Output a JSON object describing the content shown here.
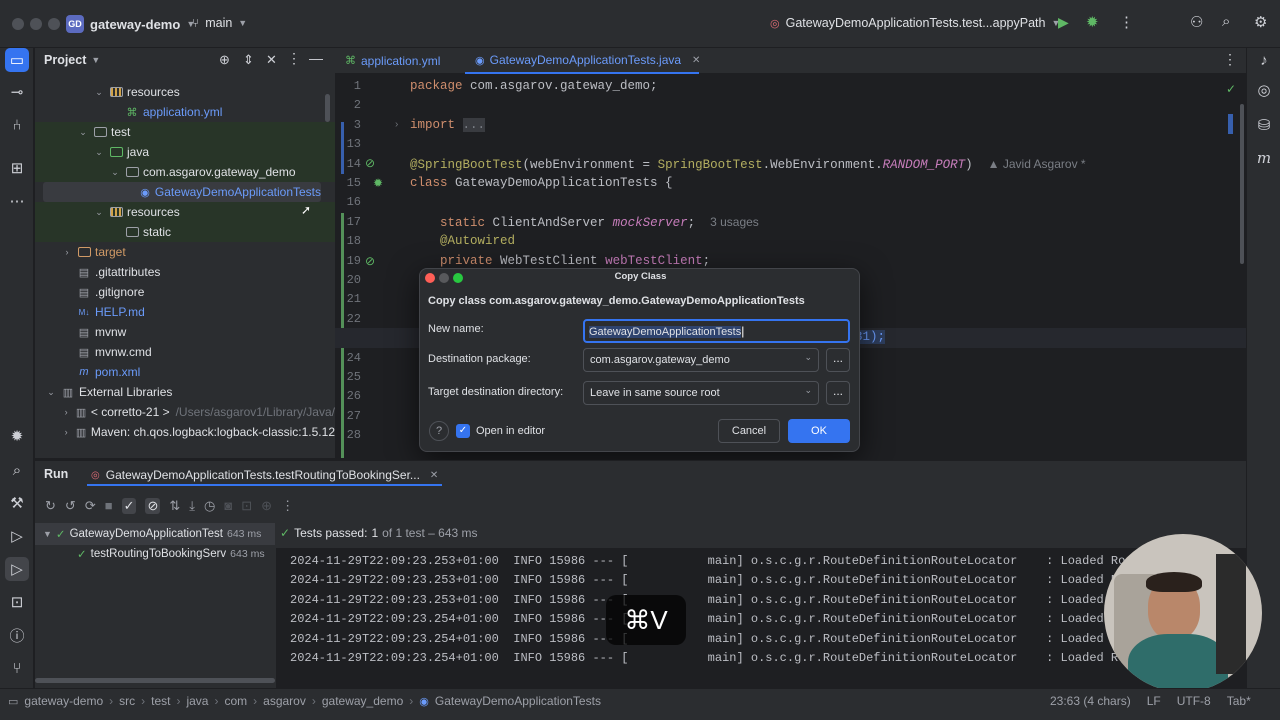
{
  "titlebar": {
    "project_badge": "GD",
    "project": "gateway-demo",
    "branch": "main",
    "run_config": "GatewayDemoApplicationTests.test...appyPath"
  },
  "project_panel": {
    "title": "Project",
    "tree": [
      {
        "label": "resources",
        "indent": 3,
        "type": "res-folder",
        "open": true
      },
      {
        "label": "application.yml",
        "indent": 4,
        "type": "yml"
      },
      {
        "label": "test",
        "indent": 2,
        "type": "folder",
        "open": true
      },
      {
        "label": "java",
        "indent": 3,
        "type": "gfolder",
        "open": true
      },
      {
        "label": "com.asgarov.gateway_demo",
        "indent": 4,
        "type": "package",
        "open": true
      },
      {
        "label": "GatewayDemoApplicationTests",
        "indent": 5,
        "type": "class",
        "selected": true
      },
      {
        "label": "resources",
        "indent": 3,
        "type": "res-folder",
        "open": true
      },
      {
        "label": "static",
        "indent": 4,
        "type": "folder"
      },
      {
        "label": "target",
        "indent": 1,
        "type": "ofolder",
        "open": false
      },
      {
        "label": ".gitattributes",
        "indent": 1,
        "type": "file"
      },
      {
        "label": ".gitignore",
        "indent": 1,
        "type": "file"
      },
      {
        "label": "HELP.md",
        "indent": 1,
        "type": "md"
      },
      {
        "label": "mvnw",
        "indent": 1,
        "type": "file"
      },
      {
        "label": "mvnw.cmd",
        "indent": 1,
        "type": "file"
      },
      {
        "label": "pom.xml",
        "indent": 1,
        "type": "maven"
      },
      {
        "label": "External Libraries",
        "indent": 0,
        "type": "lib",
        "open": true
      },
      {
        "label": "< corretto-21 >",
        "hint": "/Users/asgarov1/Library/Java/",
        "indent": 1,
        "type": "lib",
        "open": false
      },
      {
        "label": "Maven: ch.qos.logback:logback-classic:1.5.12",
        "indent": 1,
        "type": "lib",
        "open": false
      }
    ]
  },
  "editor": {
    "tabs": [
      {
        "label": "application.yml",
        "active": false
      },
      {
        "label": "GatewayDemoApplicationTests.java",
        "active": true
      }
    ],
    "lines": [
      {
        "n": "1",
        "html": "<span class='kw'>package</span> com.asgarov.gateway_demo;"
      },
      {
        "n": "2",
        "html": ""
      },
      {
        "n": "3",
        "html": "<span class='kw'>import</span> <span style='background:#393b40;color:#7a7e85'>...</span>"
      },
      {
        "n": "13",
        "html": ""
      },
      {
        "n": "14",
        "html": "<span class='ann'>@SpringBootTest</span>(webEnvironment = <span class='ann'>SpringBootTest</span>.WebEnvironment.<span class='fld it'>RANDOM_PORT</span>)  <span class='cm'>▲ Javid Asgarov *</span>"
      },
      {
        "n": "15",
        "html": "<span class='kw'>class</span> GatewayDemoApplicationTests {"
      },
      {
        "n": "16",
        "html": ""
      },
      {
        "n": "17",
        "html": "    <span class='kw'>static</span> ClientAndServer <span class='fld it'>mockServer</span>;  <span class='cm'>3 usages</span>"
      },
      {
        "n": "18",
        "html": "    <span class='ann'>@Autowired</span>"
      },
      {
        "n": "19",
        "html": "    <span class='kw'>private</span> WebTestClient <span class='fld'>webTestClient</span>;"
      },
      {
        "n": "20",
        "html": ""
      },
      {
        "n": "21",
        "html": ""
      },
      {
        "n": "22",
        "html": ""
      },
      {
        "n": "23",
        "html": ""
      },
      {
        "n": "24",
        "html": ""
      },
      {
        "n": "25",
        "html": ""
      },
      {
        "n": "26",
        "html": ""
      },
      {
        "n": "27",
        "html": ""
      },
      {
        "n": "28",
        "html": ""
      }
    ],
    "line23_tail": "81);"
  },
  "dialog": {
    "title": "Copy Class",
    "header": "Copy class com.asgarov.gateway_demo.GatewayDemoApplicationTests",
    "new_name_label": "New name:",
    "new_name_value": "GatewayDemoApplicationTests",
    "dest_pkg_label": "Destination package:",
    "dest_pkg_value": "com.asgarov.gateway_demo",
    "target_dir_label": "Target destination directory:",
    "target_dir_value": "Leave in same source root",
    "open_in_editor": "Open in editor",
    "cancel": "Cancel",
    "ok": "OK",
    "help": "?",
    "browse": "..."
  },
  "run": {
    "tab_label": "Run",
    "config": "GatewayDemoApplicationTests.testRoutingToBookingSer...",
    "tests_passed": "Tests passed:",
    "tests_passed_count": "1",
    "tests_passed_detail": "of 1 test – 643 ms",
    "tree": [
      {
        "label": "GatewayDemoApplicationTest",
        "time": "643 ms"
      },
      {
        "label": "testRoutingToBookingServ",
        "time": "643 ms"
      }
    ],
    "logs": [
      "2024-11-29T22:09:23.253+01:00  INFO 15986 --- [           main] o.s.c.g.r.RouteDefinitionRouteLocator    : Loaded RoutePre",
      "2024-11-29T22:09:23.253+01:00  INFO 15986 --- [           main] o.s.c.g.r.RouteDefinitionRouteLocator    : Loaded RoutePre",
      "2024-11-29T22:09:23.253+01:00  INFO 15986 --- [           main] o.s.c.g.r.RouteDefinitionRouteLocator    : Loaded RoutePre",
      "2024-11-29T22:09:23.254+01:00  INFO 15986 --- [           main] o.s.c.g.r.RouteDefinitionRouteLocator    : Loaded RoutePre",
      "2024-11-29T22:09:23.254+01:00  INFO 15986 --- [           main] o.s.c.g.r.RouteDefinitionRouteLocator    : Loaded RoutePre",
      "2024-11-29T22:09:23.254+01:00  INFO 15986 --- [           main] o.s.c.g.r.RouteDefinitionRouteLocator    : Loaded RoutePre"
    ]
  },
  "keystroke": "⌘V",
  "statusbar": {
    "crumbs": [
      "gateway-demo",
      "src",
      "test",
      "java",
      "com",
      "asgarov",
      "gateway_demo",
      "GatewayDemoApplicationTests"
    ],
    "position": "23:63 (4 chars)",
    "line_sep": "LF",
    "encoding": "UTF-8",
    "indent": "Tab*"
  }
}
